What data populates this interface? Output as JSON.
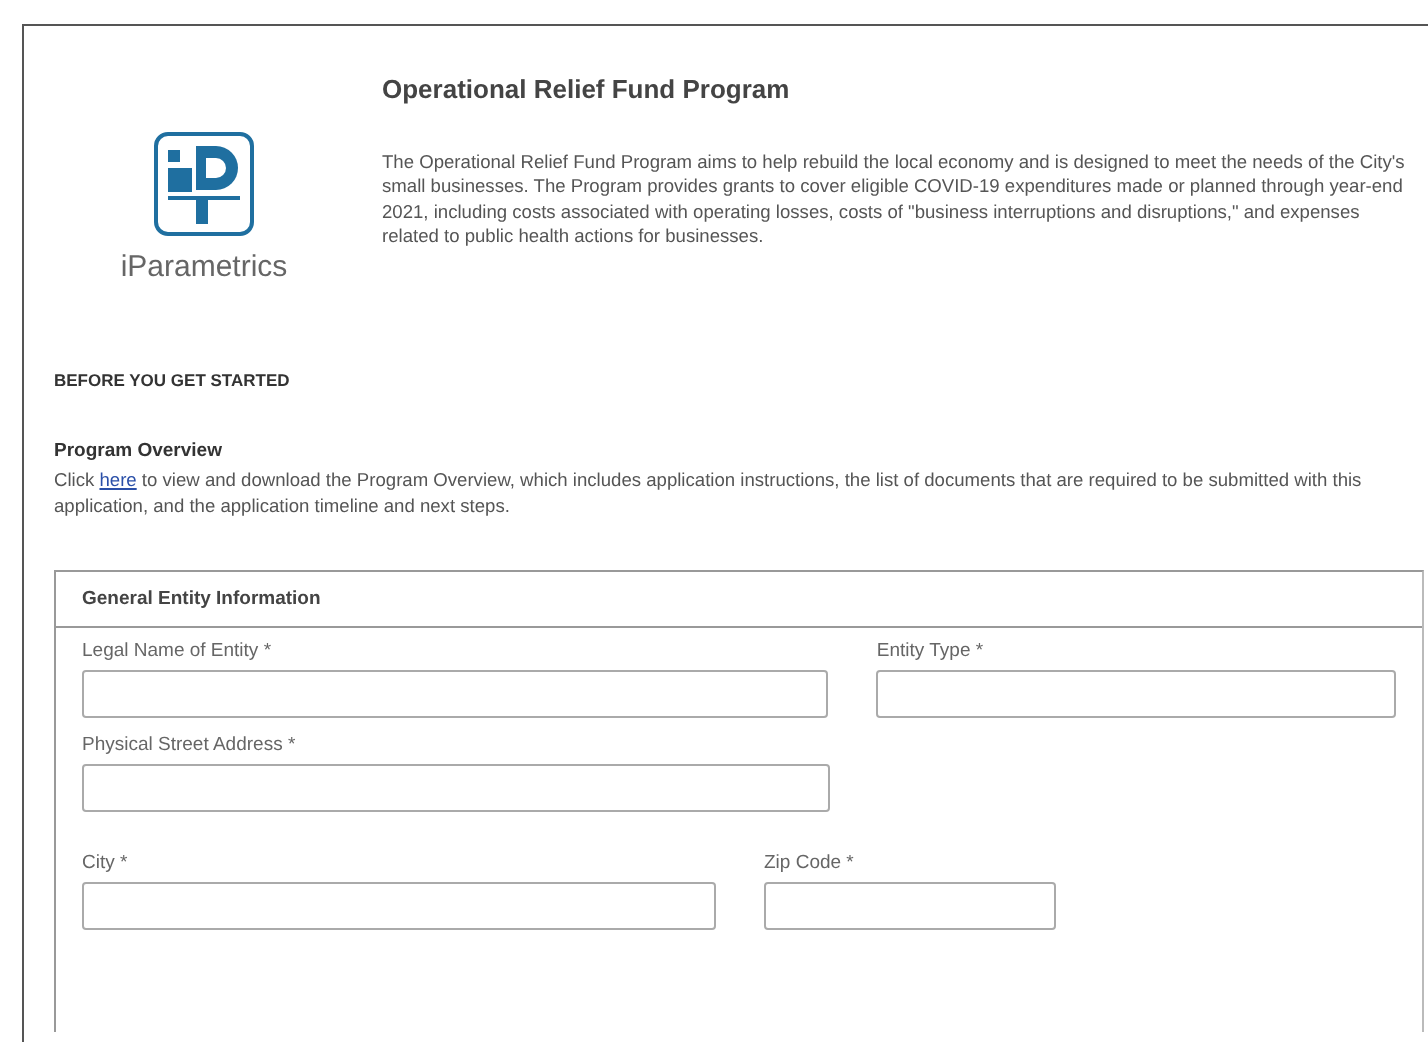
{
  "header": {
    "logo_text": "iParametrics",
    "title": "Operational Relief Fund Program",
    "description": "The Operational Relief Fund Program aims to help rebuild the local economy and is designed to meet the needs of the City's small businesses. The Program provides grants to cover eligible COVID-19 expenditures made or planned through year-end 2021, including costs associated with operating losses, costs of \"business interruptions and disruptions,\" and expenses related to public health actions for businesses."
  },
  "section_heading": "BEFORE YOU GET STARTED",
  "overview": {
    "title": "Program Overview",
    "text_before": "Click ",
    "link": "here",
    "text_after": " to view and download the Program Overview, which includes application instructions, the list of documents that are required to be submitted with this application, and the application timeline and next steps."
  },
  "panel": {
    "title": "General Entity Information",
    "rows": [
      [
        {
          "label": "Legal Name of Entity *",
          "kind": "long"
        },
        {
          "label": "Entity Type *",
          "kind": "medium"
        }
      ],
      [
        {
          "label": "Physical Street Address *",
          "kind": "long"
        }
      ],
      [
        {
          "label": "City *",
          "kind": "city"
        },
        {
          "label": "Zip Code *",
          "kind": "short"
        }
      ]
    ]
  }
}
